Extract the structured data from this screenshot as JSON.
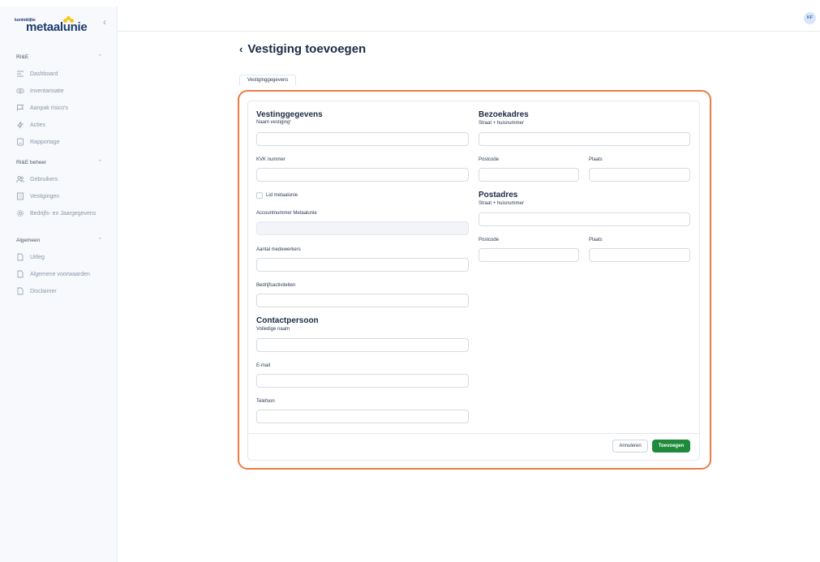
{
  "sidebar": {
    "logo_small": "koninklijke",
    "logo_big": "metaalunie",
    "sections": [
      {
        "title": "RI&E",
        "items": [
          {
            "label": "Dashboard",
            "icon": "dashboard-icon"
          },
          {
            "label": "Inventarisatie",
            "icon": "eye-icon"
          },
          {
            "label": "Aanpak risico's",
            "icon": "flag-icon"
          },
          {
            "label": "Acties",
            "icon": "lightning-icon"
          },
          {
            "label": "Rapportage",
            "icon": "report-icon"
          }
        ]
      },
      {
        "title": "RI&E beheer",
        "items": [
          {
            "label": "Gebruikers",
            "icon": "users-icon"
          },
          {
            "label": "Vestigingen",
            "icon": "building-icon"
          },
          {
            "label": "Bedrijfs- en Jaargegevens",
            "icon": "gear-icon"
          }
        ]
      },
      {
        "title": "Algemeen",
        "items": [
          {
            "label": "Uitleg",
            "icon": "document-icon"
          },
          {
            "label": "Algemene voorwaarden",
            "icon": "document-icon"
          },
          {
            "label": "Disclaimer",
            "icon": "document-icon"
          }
        ]
      }
    ]
  },
  "header": {
    "avatar_initials": "KF"
  },
  "page": {
    "title": "Vestiging toevoegen",
    "tab": "Vestiginggegevens"
  },
  "form": {
    "left": {
      "section_title": "Vestinggegevens",
      "naam_label": "Naam vestiging",
      "naam_required": "*",
      "kvk_label": "KVK nummer",
      "lid_label": "Lid metaalunie",
      "account_label": "Accountnummer Metaalunie",
      "medewerkers_label": "Aantal medewerkers",
      "activiteiten_label": "Bedrijfsactiviteiten",
      "contact_title": "Contactpersoon",
      "naam_contact_label": "Volledige naam",
      "email_label": "E-mail",
      "telefoon_label": "Telefoon"
    },
    "right": {
      "bezoek_title": "Bezoekadres",
      "bezoek_straat_label": "Straat + huisnummer",
      "bezoek_postcode_label": "Postcode",
      "bezoek_plaats_label": "Plaats",
      "post_title": "Postadres",
      "post_straat_label": "Straat + huisnummer",
      "post_postcode_label": "Postcode",
      "post_plaats_label": "Plaats"
    },
    "values": {
      "naam": "",
      "kvk": "",
      "account": "",
      "medewerkers": "",
      "activiteiten": "",
      "contact_naam": "",
      "email": "",
      "telefoon": "",
      "bezoek_straat": "",
      "bezoek_postcode": "",
      "bezoek_plaats": "",
      "post_straat": "",
      "post_postcode": "",
      "post_plaats": ""
    },
    "lid_checked": false
  },
  "buttons": {
    "cancel": "Annuleren",
    "submit": "Toevoegen"
  },
  "colors": {
    "accent_orange": "#ee7b45",
    "submit_green": "#1f8a3c",
    "brand_navy": "#1d3b6e",
    "logo_yellow": "#f5c518"
  }
}
